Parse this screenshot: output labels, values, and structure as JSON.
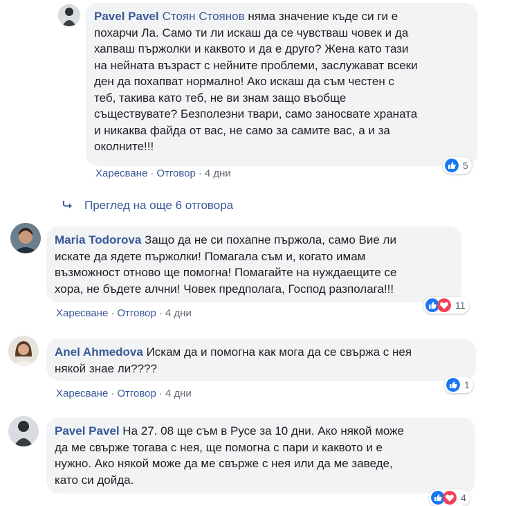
{
  "comments": [
    {
      "author": "Pavel Pavel",
      "mention": "Стоян Стоянов",
      "lines": [
        " няма значение къде си ги е",
        "похарчи Ла. Само ти ли искаш да се чувстваш човек и да",
        "хапваш пържолки и каквото и да е друго? Жена като тази",
        "на нейната възраст с нейните проблеми, заслужават всеки",
        "ден да похапват нормално! Ако искаш да съм честен с",
        "теб, такива като теб, не ви знам защо въобще",
        "съществувате? Безполезни твари, само заносвате храната",
        "и никаква файда от вас, не само за самите вас, а и за",
        "околните!!!"
      ],
      "like": "Харесване",
      "reply": "Отговор",
      "time": "4 дни",
      "reactions": "5"
    },
    {
      "author": "Maria Todorova",
      "lines": [
        " Защо да не си похапне пържола, само Вие ли",
        "искате да ядете пържолки! Помагала съм и, когато имам",
        "възможност отново ще помогна! Помагайте на нуждаещите се",
        "хора, не бъдете алчни! Човек предполага, Господ разполага!!!"
      ],
      "like": "Харесване",
      "reply": "Отговор",
      "time": "4 дни",
      "reactions": "11"
    },
    {
      "author": "Anel Ahmedova",
      "lines": [
        " Искам да и помогна как мога да се свържа с нея",
        "някой знае ли????"
      ],
      "like": "Харесване",
      "reply": "Отговор",
      "time": "4 дни",
      "reactions": "1"
    },
    {
      "author": "Pavel Pavel",
      "lines": [
        " На 27. 08 ще съм в Русе за 10 дни. Ако някой може",
        "да ме свърже тогава с нея, ще помогна с пари и каквото и е",
        "нужно. Ако някой може да ме свърже с нея или да ме заведе,",
        "като си дойда."
      ],
      "reactions": "4"
    }
  ],
  "more_replies": "Преглед на още 6 отговора",
  "separator": "·",
  "colors": {
    "link": "#385898",
    "bubble": "#f2f3f5",
    "like": "#1877f2",
    "love": "#f33e58"
  }
}
